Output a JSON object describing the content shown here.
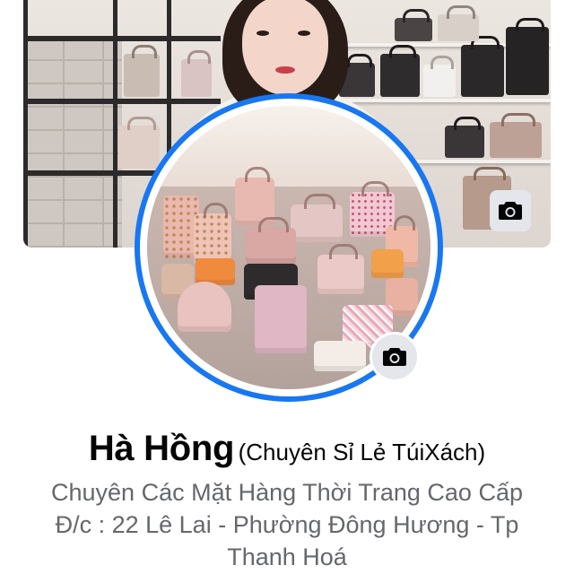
{
  "profile": {
    "name": "Hà Hồng",
    "subtitle": "(Chuyên Sỉ Lẻ TúiXách)",
    "bio_lines": [
      "Chuyên Các Mặt Hàng Thời Trang Cao Cấp",
      "Đ/c : 22 Lê Lai - Phường Đông Hương - Tp",
      "Thanh Hoá"
    ]
  },
  "icons": {
    "cover_camera": "camera-icon",
    "avatar_camera": "camera-icon"
  },
  "colors": {
    "avatar_ring": "#1877f2",
    "camera_button_bg": "#e4e6eb",
    "name_text": "#050505",
    "bio_text": "#65676b"
  }
}
